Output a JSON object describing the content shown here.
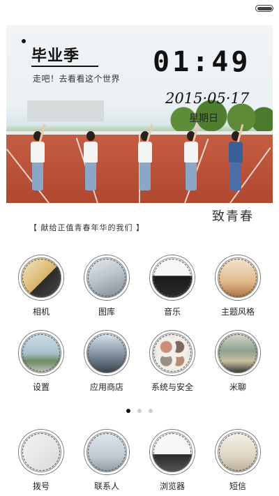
{
  "status_bar": {
    "battery_icon": "battery-icon"
  },
  "widget": {
    "title": "毕业季",
    "subtitle": "走吧！去看看这个世界",
    "time": "01:49",
    "date": "2015·05·17",
    "weekday": "星期日",
    "tagline": "致青春",
    "dedication": "【 献给正值青春年华的我们 】"
  },
  "apps_row1": [
    {
      "label": "相机",
      "icon": "camera-icon"
    },
    {
      "label": "图库",
      "icon": "gallery-icon"
    },
    {
      "label": "音乐",
      "icon": "music-icon"
    },
    {
      "label": "主题风格",
      "icon": "theme-icon"
    }
  ],
  "apps_row2": [
    {
      "label": "设置",
      "icon": "settings-icon"
    },
    {
      "label": "应用商店",
      "icon": "app-store-icon"
    },
    {
      "label": "系统与安全",
      "icon": "security-icon"
    },
    {
      "label": "米聊",
      "icon": "miliao-icon"
    }
  ],
  "pager": {
    "pages": 3,
    "current": 1
  },
  "dock": [
    {
      "label": "拨号",
      "icon": "dialer-icon"
    },
    {
      "label": "联系人",
      "icon": "contacts-icon"
    },
    {
      "label": "浏览器",
      "icon": "browser-icon"
    },
    {
      "label": "短信",
      "icon": "sms-icon"
    }
  ]
}
